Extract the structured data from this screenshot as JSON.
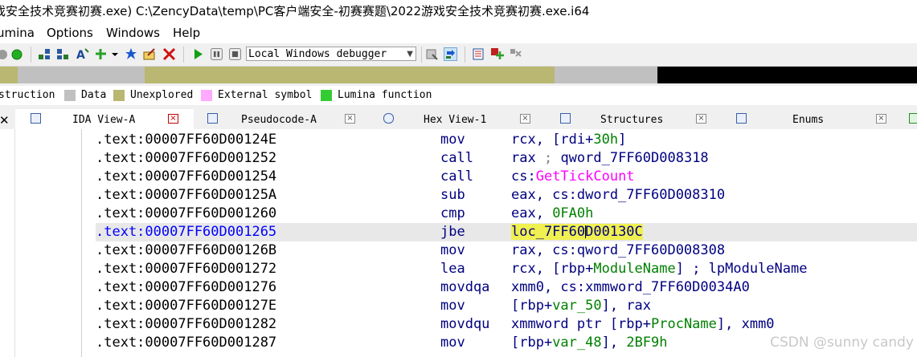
{
  "window": {
    "title": "戏安全技术竞赛初赛.exe) C:\\ZencyData\\temp\\PC客户端安全-初赛赛题\\2022游戏安全技术竞赛初赛.exe.i64"
  },
  "menu": [
    "umina",
    "Options",
    "Windows",
    "Help"
  ],
  "toolbar": {
    "debugger": "Local Windows debugger",
    "icons": [
      "gray-circle-icon",
      "green-circle-icon",
      "graph-icon",
      "graph-icon",
      "text-icon",
      "add-icon",
      "dropdown-icon",
      "star-icon",
      "edit-icon",
      "close-icon",
      "play-icon",
      "pause-icon",
      "stop-icon",
      "debug-icon",
      "refresh-icon",
      "grid-icon",
      "cross-icon",
      "add-breakpoint-icon"
    ]
  },
  "colors": {
    "instruction": "#c0c0c0",
    "data": "#c0c0c0",
    "unexplored": "#b9b771",
    "external_symbol": "#ffaaff",
    "lumina_function": "#33cc33",
    "highlight": "#f0f050",
    "address": "#000000",
    "address_selected": "#0000ff",
    "mnemonic": "#000080"
  },
  "legend": [
    {
      "label": "struction",
      "color": "#c0c0c0"
    },
    {
      "label": "Data",
      "color": "#c0c0c0"
    },
    {
      "label": "Unexplored",
      "color": "#b9b771"
    },
    {
      "label": "External symbol",
      "color": "#ffaaff"
    },
    {
      "label": "Lumina function",
      "color": "#33cc33"
    }
  ],
  "tabs": [
    {
      "label": "IDA View-A",
      "active": true
    },
    {
      "label": "Pseudocode-A",
      "active": false
    },
    {
      "label": "Hex View-1",
      "active": false
    },
    {
      "label": "Structures",
      "active": false
    },
    {
      "label": "Enums",
      "active": false
    }
  ],
  "code": [
    {
      "addr": ".text:00007FF60D00124E",
      "mn": "mov"
    },
    {
      "addr": ".text:00007FF60D001252",
      "mn": "call"
    },
    {
      "addr": ".text:00007FF60D001254",
      "mn": "call"
    },
    {
      "addr": ".text:00007FF60D00125A",
      "mn": "sub"
    },
    {
      "addr": ".text:00007FF60D001260",
      "mn": "cmp"
    },
    {
      "addr": ".text:00007FF60D001265",
      "mn": "jbe",
      "selected": true
    },
    {
      "addr": ".text:00007FF60D00126B",
      "mn": "mov"
    },
    {
      "addr": ".text:00007FF60D001272",
      "mn": "lea"
    },
    {
      "addr": ".text:00007FF60D001276",
      "mn": "movdqa"
    },
    {
      "addr": ".text:00007FF60D00127E",
      "mn": "mov"
    },
    {
      "addr": ".text:00007FF60D001282",
      "mn": "movdqu"
    },
    {
      "addr": ".text:00007FF60D001287",
      "mn": "mov"
    }
  ],
  "operands": {
    "r0_a": "rcx, [rdi+",
    "r0_n": "30h",
    "r0_b": "]",
    "r1_a": "rax",
    "r1_g": " ; ",
    "r1_b": "qword_7FF60D008318",
    "r2_a": "cs:",
    "r2_p": "GetTickCount",
    "r3": "eax, cs:dword_7FF60D008310",
    "r4_a": "eax, ",
    "r4_n": "0FA0h",
    "r5_a": "loc_7FF60",
    "r5_b": "D00130C",
    "r6": "rax, cs:qword_7FF60D008308",
    "r7_a": "rcx, [rbp+",
    "r7_b": "ModuleName",
    "r7_c": "] ; lpModuleName",
    "r8": "xmm0, cs:xmmword_7FF60D0034A0",
    "r9_a": "[rbp+",
    "r9_b": "var_50",
    "r9_c": "], rax",
    "r10_a": "xmmword ptr [rbp+",
    "r10_b": "ProcName",
    "r10_c": "], xmm0",
    "r11_a": "[rbp+",
    "r11_b": "var_48",
    "r11_c": "], ",
    "r11_n": "2BF9h"
  },
  "watermark": "CSDN @sunny candy"
}
